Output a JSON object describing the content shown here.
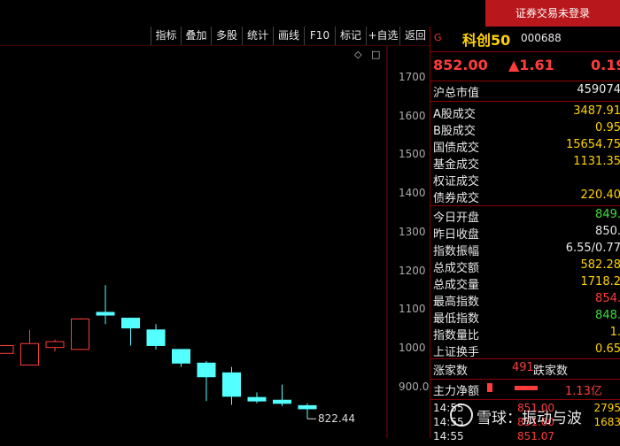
{
  "topbar": {
    "login_status": "证券交易未登录"
  },
  "toolbar": {
    "items": [
      "指标",
      "叠加",
      "多股",
      "统计",
      "画线",
      "F10",
      "标记",
      "+自选",
      "返回"
    ]
  },
  "chart": {
    "y_ticks": [
      "1700",
      "1600",
      "1500",
      "1400",
      "1300",
      "1200",
      "1100",
      "1000",
      "900.0"
    ],
    "last_low_label": "822.44",
    "controls": {
      "diamond": "◇",
      "square": "□"
    },
    "up_color": "#ff3c3c",
    "down_color": "#54ffff",
    "candles": [
      {
        "o": 990,
        "c": 1010,
        "h": 1010,
        "l": 990,
        "dir": "up"
      },
      {
        "o": 960,
        "c": 1015,
        "h": 1050,
        "l": 960,
        "dir": "up"
      },
      {
        "o": 1005,
        "c": 1020,
        "h": 1025,
        "l": 995,
        "dir": "up"
      },
      {
        "o": 1000,
        "c": 1078,
        "h": 1080,
        "l": 1000,
        "dir": "up"
      },
      {
        "o": 1088,
        "c": 1095,
        "h": 1165,
        "l": 1065,
        "dir": "down"
      },
      {
        "o": 1080,
        "c": 1055,
        "h": 1080,
        "l": 1010,
        "dir": "down"
      },
      {
        "o": 1050,
        "c": 1010,
        "h": 1065,
        "l": 1000,
        "dir": "down"
      },
      {
        "o": 1000,
        "c": 965,
        "h": 1000,
        "l": 955,
        "dir": "down"
      },
      {
        "o": 965,
        "c": 930,
        "h": 970,
        "l": 868,
        "dir": "down"
      },
      {
        "o": 940,
        "c": 880,
        "h": 955,
        "l": 858,
        "dir": "down"
      },
      {
        "o": 877,
        "c": 868,
        "h": 890,
        "l": 862,
        "dir": "down"
      },
      {
        "o": 870,
        "c": 862,
        "h": 910,
        "l": 855,
        "dir": "down"
      },
      {
        "o": 856,
        "c": 848,
        "h": 862,
        "l": 822.44,
        "dir": "down"
      }
    ]
  },
  "quote": {
    "g_mark": "G",
    "name": "科创50",
    "code": "000688",
    "price": "852.00",
    "change": "▲1.61",
    "change_pct": "0.19",
    "market_cap": {
      "label": "沪总市值",
      "value": "459074"
    },
    "stats_a": [
      {
        "label": "A股成交",
        "value": "3487.91",
        "color": "#ffd200"
      },
      {
        "label": "B股成交",
        "value": "0.95",
        "color": "#ffd200"
      },
      {
        "label": "国债成交",
        "value": "15654.75",
        "color": "#ffd200"
      },
      {
        "label": "基金成交",
        "value": "1131.35",
        "color": "#ffd200"
      },
      {
        "label": "权证成交",
        "value": "",
        "color": "#ffd200"
      },
      {
        "label": "债券成交",
        "value": "220.40",
        "color": "#ffd200"
      }
    ],
    "stats_b": [
      {
        "label": "今日开盘",
        "value": "849.",
        "color": "#3ddc3d"
      },
      {
        "label": "昨日收盘",
        "value": "850.",
        "color": "#e8e8e8"
      },
      {
        "label": "指数振幅",
        "value": "6.55/0.77",
        "color": "#e8e8e8"
      },
      {
        "label": "总成交额",
        "value": "582.28",
        "color": "#ffd200"
      },
      {
        "label": "总成交量",
        "value": "1718.2",
        "color": "#ffd200"
      },
      {
        "label": "最高指数",
        "value": "854.",
        "color": "#ff3c3c"
      },
      {
        "label": "最低指数",
        "value": "848.",
        "color": "#3ddc3d"
      },
      {
        "label": "指数量比",
        "value": "1.",
        "color": "#ffd200"
      },
      {
        "label": "上证换手",
        "value": "0.65",
        "color": "#ffd200"
      }
    ],
    "rise_fall": {
      "rise_label": "涨家数",
      "rise_value": "491",
      "fall_label": "跌家数"
    },
    "main_flow": {
      "label": "主力净额",
      "value": "1.13亿"
    },
    "ticks": [
      {
        "time": "14:55",
        "price": "851.00",
        "vol": "2795"
      },
      {
        "time": "14:55",
        "price": "851.00",
        "vol": "1683"
      },
      {
        "time": "14:55",
        "price": "851.07",
        "vol": ""
      }
    ]
  },
  "watermark": {
    "text": "雪球：振动与波"
  }
}
